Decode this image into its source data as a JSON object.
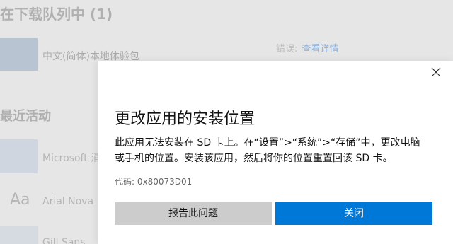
{
  "background": {
    "queue_title": "在下载队列中 (1)",
    "download_item_name": "中文(简体)本地体验包",
    "download_item_status_label": "错误:",
    "download_item_link": "查看详情",
    "recent_title": "最近活动",
    "recent_items": [
      {
        "name": "Microsoft 消"
      },
      {
        "name": "Arial Nova"
      },
      {
        "name": "Gill Sans"
      }
    ]
  },
  "dialog": {
    "title": "更改应用的安装位置",
    "body_line1": "此应用无法安装在 SD 卡上。在“设置”>“系统”>“存储”中，更改电脑",
    "body_line2": "或手机的位置。安装该应用，然后将你的位置重置回该 SD 卡。",
    "code": "代码: 0x80073D01",
    "report_button": "报告此问题",
    "close_button": "关闭"
  },
  "colors": {
    "accent": "#0078d7",
    "secondary_button": "#cccccc",
    "dialog_bg": "#ffffff",
    "backdrop": "#e6e6e6"
  },
  "icons": {
    "close": "close-icon",
    "font_preview": "font-preview-icon",
    "app_tile": "app-tile-icon"
  }
}
